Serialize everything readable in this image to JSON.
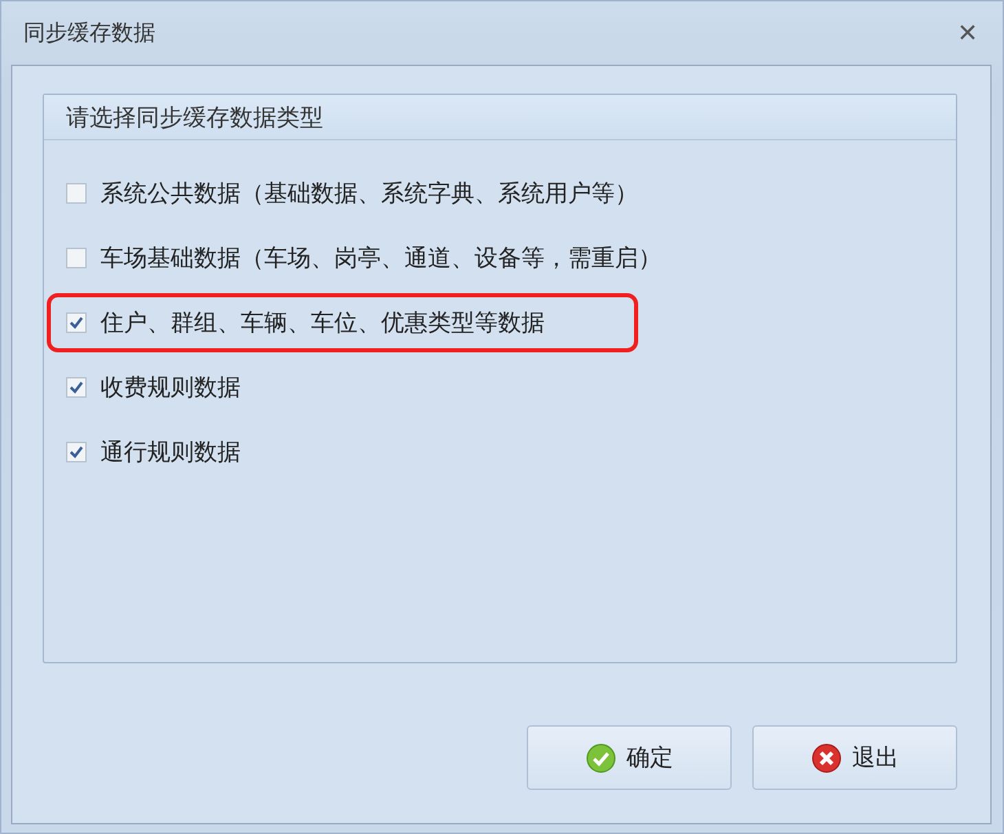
{
  "window": {
    "title": "同步缓存数据",
    "close": "✕"
  },
  "group": {
    "title": "请选择同步缓存数据类型",
    "options": [
      {
        "label": "系统公共数据（基础数据、系统字典、系统用户等）",
        "checked": false,
        "highlighted": false
      },
      {
        "label": "车场基础数据（车场、岗亭、通道、设备等，需重启）",
        "checked": false,
        "highlighted": false
      },
      {
        "label": "住户、群组、车辆、车位、优惠类型等数据",
        "checked": true,
        "highlighted": true
      },
      {
        "label": "收费规则数据",
        "checked": true,
        "highlighted": false
      },
      {
        "label": "通行规则数据",
        "checked": true,
        "highlighted": false
      }
    ]
  },
  "buttons": [
    {
      "label": "确定",
      "kind": "ok"
    },
    {
      "label": "退出",
      "kind": "cancel"
    }
  ]
}
